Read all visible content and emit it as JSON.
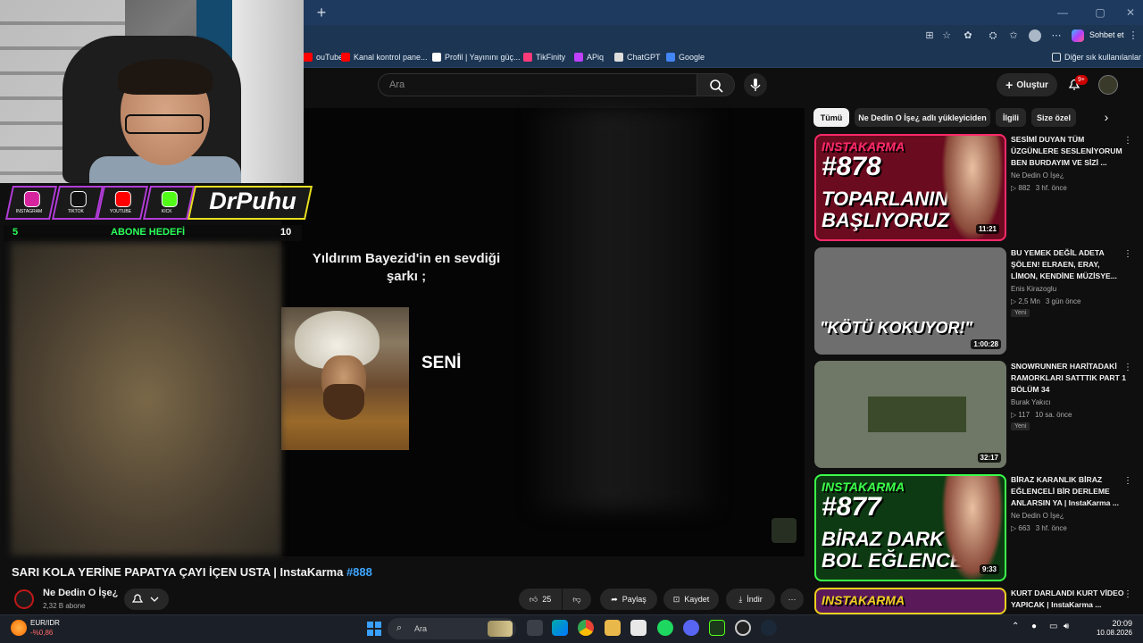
{
  "browser": {
    "new_tab": "+",
    "chat_button": "Sohbet et",
    "other_bookmarks": "Diğer sık kullanılanlar",
    "bookmarks": [
      {
        "label": "ouTube",
        "color": "#ff0000"
      },
      {
        "label": "Kanal kontrol pane...",
        "color": "#ff0000"
      },
      {
        "label": "Profil | Yayınını güç...",
        "color": "#ffffff"
      },
      {
        "label": "TikFinity",
        "color": "#ff3b7a"
      },
      {
        "label": "APiq",
        "color": "#c040ff"
      },
      {
        "label": "ChatGPT",
        "color": "#dddddd"
      },
      {
        "label": "Google",
        "color": "#4285f4"
      }
    ]
  },
  "youtube": {
    "search_placeholder": "Ara",
    "create_label": "Oluştur",
    "notif_badge": "9+",
    "chips": [
      "Tümü",
      "Ne Dedin O İşe¿ adlı yükleyiciden",
      "İlgili",
      "Size özel"
    ]
  },
  "video": {
    "caption": "Yıldırım Bayezid'in en sevdiği şarkı ;",
    "overlay_word": "SENİ",
    "title": "SARI KOLA YERİNE PAPATYA ÇAYI İÇEN USTA | InstaKarma",
    "hashtag": "#888",
    "channel": "Ne Dedin O İşe¿",
    "subscribers": "2,32 B abone",
    "likes": "25",
    "share": "Paylaş",
    "save": "Kaydet",
    "download": "İndir"
  },
  "overlay": {
    "socials": [
      {
        "label": "INSTAGRAM",
        "color": "#d6249f"
      },
      {
        "label": "TIKTOK",
        "color": "#111111"
      },
      {
        "label": "YOUTUBE",
        "color": "#ff0000"
      },
      {
        "label": "KICK",
        "color": "#53fc18"
      }
    ],
    "brand": "DrPuhu",
    "goal_start": "5",
    "goal_label": "ABONE HEDEFİ",
    "goal_end": "10"
  },
  "sidebar": [
    {
      "title": "SESİMİ DUYAN TÜM ÜZGÜNLERE SESLENİYORUM BEN BURDAYIM VE SİZİ ...",
      "channel": "Ne Dedin O İşe¿",
      "views": "882",
      "age": "3 hf. önce",
      "duration": "11:21",
      "new": "",
      "thumb_text_1": "INSTAKARMA",
      "thumb_text_2": "#878",
      "thumb_text_3": "TOPARLANIN",
      "thumb_text_4": "BAŞLIYORUZ",
      "border": "#ff2a6a",
      "bg": "#6a0b1f"
    },
    {
      "title": "BU YEMEK DEĞİL ADETA ŞÖLEN! ELRAEN, ERAY, LİMON, KENDİNE MÜZİSYE...",
      "channel": "Enis Kirazoglu",
      "views": "2,5 Mn",
      "age": "3 gün önce",
      "duration": "1:00:28",
      "new": "Yeni",
      "thumb_text_1": "",
      "thumb_text_2": "",
      "thumb_text_3": "\"KÖTÜ KOKUYOR!\"",
      "thumb_text_4": "",
      "border": "",
      "bg": "#6e6e6e"
    },
    {
      "title": "SNOWRUNNER HARİTADAKİ RAMORKLARI SATTTIK PART 1 BÖLÜM 34",
      "channel": "Burak Yakıcı",
      "views": "117",
      "age": "10 sa. önce",
      "duration": "32:17",
      "new": "Yeni",
      "thumb_text_1": "",
      "thumb_text_2": "",
      "thumb_text_3": "",
      "thumb_text_4": "",
      "border": "",
      "bg": "#6f7766"
    },
    {
      "title": "BİRAZ KARANLIK BİRAZ EĞLENCELİ BİR DERLEME ANLARSIN YA | InstaKarma ...",
      "channel": "Ne Dedin O İşe¿",
      "views": "663",
      "age": "3 hf. önce",
      "duration": "9:33",
      "new": "",
      "thumb_text_1": "INSTAKARMA",
      "thumb_text_2": "#877",
      "thumb_text_3": "BİRAZ DARK",
      "thumb_text_4": "BOL EĞLENCE",
      "border": "#3cff4a",
      "bg": "#0d3a12"
    },
    {
      "title": "KURT DARLANDI KURT VİDEO YAPICAK | InstaKarma ...",
      "channel": "",
      "views": "",
      "age": "",
      "duration": "",
      "new": "",
      "thumb_text_1": "INSTAKARMA",
      "thumb_text_2": "",
      "thumb_text_3": "",
      "thumb_text_4": "",
      "border": "#f0d020",
      "bg": "#5a1a5a"
    }
  ],
  "taskbar": {
    "search": "Ara",
    "forex_name": "EUR/IDR",
    "forex_change": "-%0,86",
    "time": "20:09",
    "date": "10.08.2026"
  }
}
